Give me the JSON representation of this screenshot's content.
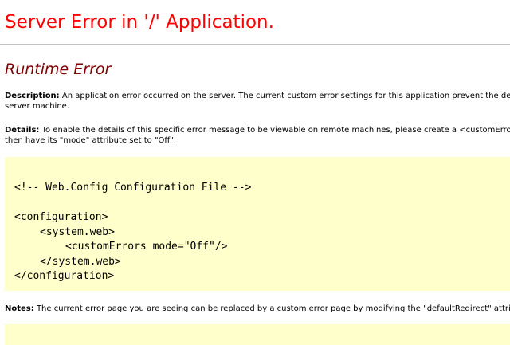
{
  "heading": "Server Error in '/' Application.",
  "subheading": "Runtime Error",
  "description": {
    "label": "Description:",
    "line1": " An application error occurred on the server. The current custom error settings for this application prevent the det",
    "line2": "server machine."
  },
  "details": {
    "label": "Details:",
    "line1": " To enable the details of this specific error message to be viewable on remote machines, please create a <customErrors",
    "line2": "then have its \"mode\" attribute set to \"Off\"."
  },
  "config_code": {
    "comment": "<!-- Web.Config Configuration File -->",
    "open_configuration": "<configuration>",
    "open_system_web": "<system.web>",
    "custom_errors": "<customErrors mode=\"Off\"/>",
    "close_system_web": "</system.web>",
    "close_configuration": "</configuration>"
  },
  "notes": {
    "label": "Notes:",
    "line1": " The current error page you are seeing can be replaced by a custom error page by modifying the \"defaultRedirect\" attribu"
  },
  "colors": {
    "heading": "#ff0000",
    "subheading": "#800000",
    "code_background": "#ffffcc",
    "rule": "#c0c0c0"
  }
}
